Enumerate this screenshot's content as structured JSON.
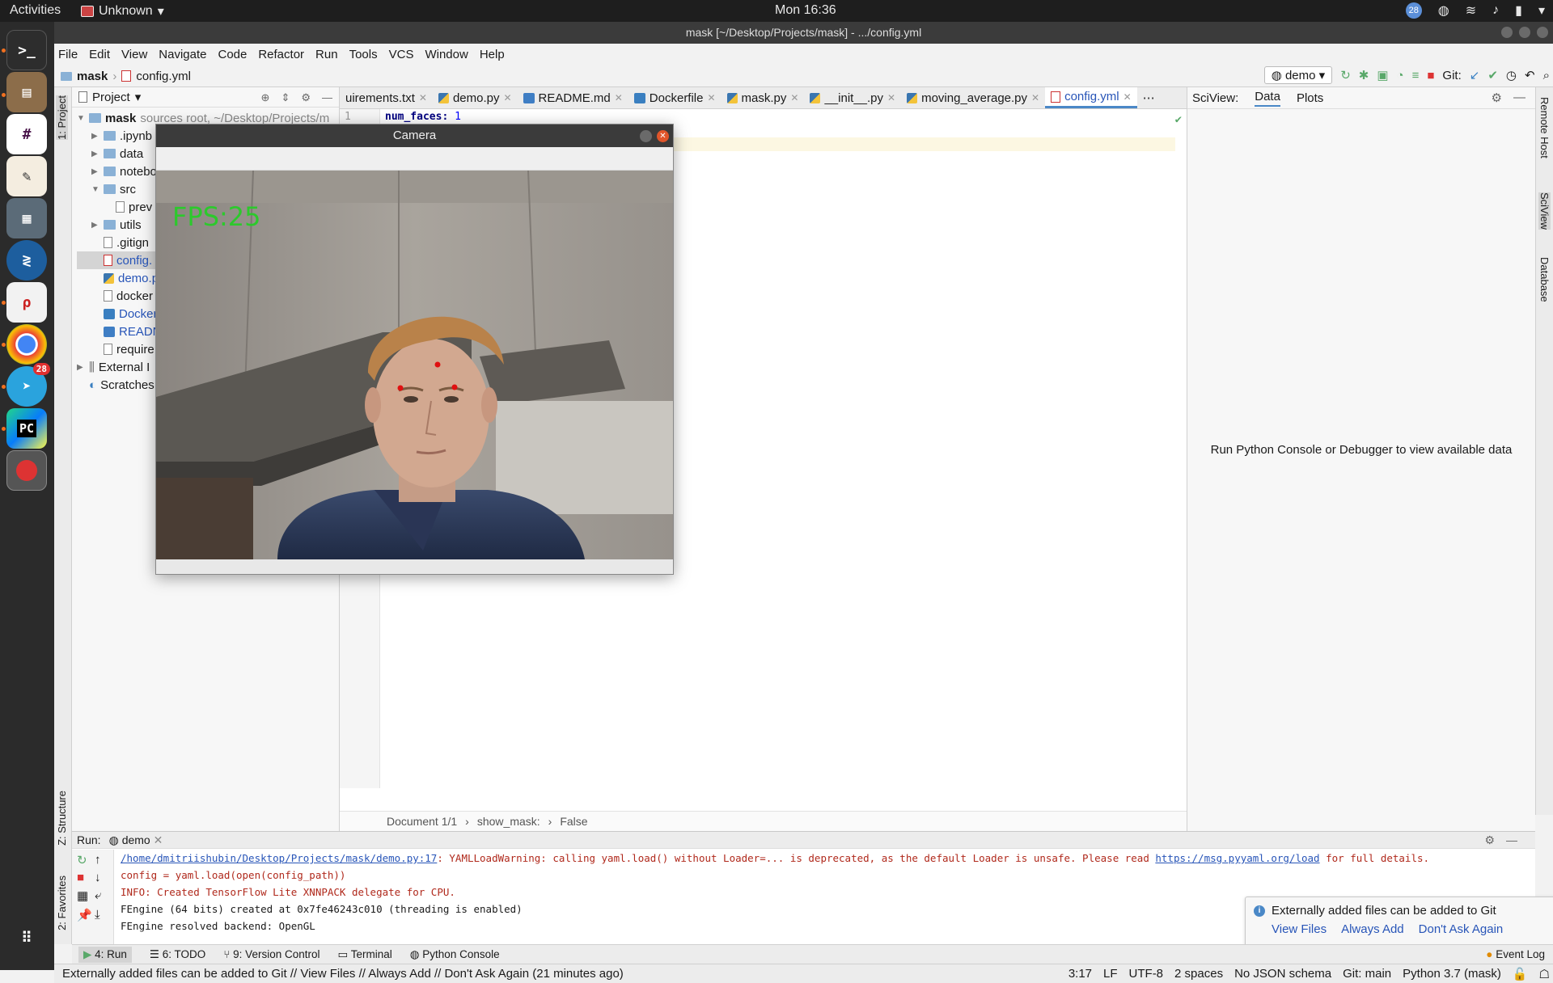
{
  "topbar": {
    "activities": "Activities",
    "app_name": "Unknown",
    "clock": "Mon 16:36",
    "notif_count": "28"
  },
  "dock": {
    "telegram_badge": "28",
    "items": [
      "terminal-icon",
      "files-icon",
      "slack-icon",
      "text-editor-icon",
      "calculator-icon",
      "remmina-icon",
      "document-viewer-icon",
      "chrome-icon",
      "telegram-icon",
      "pycharm-icon",
      "camera-app-icon",
      "apps-grid-icon"
    ]
  },
  "window": {
    "title": "mask [~/Desktop/Projects/mask] - .../config.yml"
  },
  "menu": [
    "File",
    "Edit",
    "View",
    "Navigate",
    "Code",
    "Refactor",
    "Run",
    "Tools",
    "VCS",
    "Window",
    "Help"
  ],
  "navbar": {
    "project": "mask",
    "file": "config.yml",
    "run_config": "demo",
    "git_label": "Git:"
  },
  "project_panel": {
    "title": "Project",
    "root_name": "mask",
    "root_hint": "sources root, ~/Desktop/Projects/m",
    "items": [
      {
        "name": ".ipynb",
        "kind": "folder"
      },
      {
        "name": "data",
        "kind": "folder"
      },
      {
        "name": "notebo",
        "kind": "folder"
      },
      {
        "name": "src",
        "kind": "folder"
      },
      {
        "name": "prev",
        "kind": "file"
      },
      {
        "name": "utils",
        "kind": "folder"
      },
      {
        "name": ".gitign",
        "kind": "file"
      },
      {
        "name": "config.",
        "kind": "yml"
      },
      {
        "name": "demo.p",
        "kind": "py"
      },
      {
        "name": "docker",
        "kind": "file"
      },
      {
        "name": "Docker",
        "kind": "file"
      },
      {
        "name": "READN",
        "kind": "md"
      },
      {
        "name": "require",
        "kind": "file"
      }
    ],
    "external": "External I",
    "scratches": "Scratches"
  },
  "tabs": [
    {
      "label": "uirements.txt",
      "active": false
    },
    {
      "label": "demo.py",
      "active": false
    },
    {
      "label": "README.md",
      "active": false
    },
    {
      "label": "Dockerfile",
      "active": false
    },
    {
      "label": "mask.py",
      "active": false
    },
    {
      "label": "__init__.py",
      "active": false
    },
    {
      "label": "moving_average.py",
      "active": false
    },
    {
      "label": "config.yml",
      "active": true
    }
  ],
  "editor": {
    "line_number": "1",
    "key": "num_faces",
    "value": "1",
    "breadcrumb": [
      "Document 1/1",
      "show_mask:",
      "False"
    ]
  },
  "sciview": {
    "title": "SciView:",
    "tab_data": "Data",
    "tab_plots": "Plots",
    "message": "Run Python Console or Debugger to view available data"
  },
  "right_strip": [
    "Remote Host",
    "SciView",
    "Database"
  ],
  "left_strip": [
    "1: Project",
    "Z: Structure",
    "2: Favorites"
  ],
  "run_panel": {
    "label": "Run:",
    "config": "demo",
    "lines": [
      {
        "link": "/home/dmitriishubin/Desktop/Projects/mask/demo.py:17",
        "text": ": YAMLLoadWarning: calling yaml.load() without Loader=... is deprecated, as the default Loader is unsafe. Please read ",
        "url": "https://msg.pyyaml.org/load",
        "tail": " for full details."
      },
      {
        "text": "  config = yaml.load(open(config_path))"
      },
      {
        "text": "INFO: Created TensorFlow Lite XNNPACK delegate for CPU."
      },
      {
        "text": "FEngine (64 bits) created at 0x7fe46243c010 (threading is enabled)"
      },
      {
        "text": "FEngine resolved backend: OpenGL"
      }
    ]
  },
  "notification": {
    "title": "Externally added files can be added to Git",
    "actions": [
      "View Files",
      "Always Add",
      "Don't Ask Again"
    ]
  },
  "tool_tabs": [
    "4: Run",
    "6: TODO",
    "9: Version Control",
    "Terminal",
    "Python Console"
  ],
  "event_log": "Event Log",
  "status": {
    "message": "Externally added files can be added to Git // View Files // Always Add // Don't Ask Again (21 minutes ago)",
    "items": [
      "3:17",
      "LF",
      "UTF-8",
      "2 spaces",
      "No JSON schema",
      "Git: main",
      "Python 3.7 (mask)"
    ]
  },
  "camera": {
    "title": "Camera",
    "fps_text": "FPS:25"
  },
  "colors": {
    "accent": "#4a88c7",
    "fps_green": "#2cc92c",
    "landmark_red": "#e01010"
  }
}
